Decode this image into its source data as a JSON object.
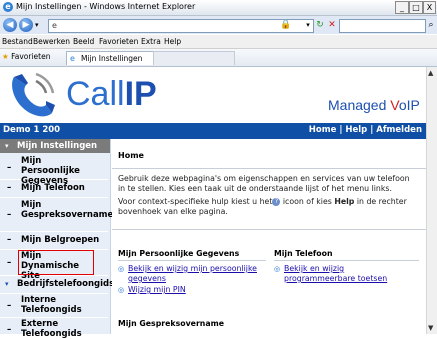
{
  "window": {
    "title": "Mijn Instellingen - Windows Internet Explorer",
    "min": "_",
    "max": "□",
    "close": "X"
  },
  "address": {
    "value": "e"
  },
  "menu": [
    "Bestand",
    "Bewerken",
    "Beeld",
    "Favorieten",
    "Extra",
    "Help"
  ],
  "favorites": {
    "label": "Favorieten",
    "tab_label": "Mijn Instellingen"
  },
  "brand": {
    "name_call": "Call",
    "name_ip": "IP",
    "tagline_managed": "Managed ",
    "tagline_v": "V",
    "tagline_oip": "oIP"
  },
  "bluebar": {
    "company": "Demo 1 200",
    "links": "Home | Help | Afmelden"
  },
  "nav": {
    "section": "Mijn Instellingen",
    "items": [
      {
        "label": "Mijn Persoonlijke Gegevens"
      },
      {
        "label": "Mijn Telefoon"
      },
      {
        "label": "Mijn Gespreksovername"
      },
      {
        "label": "Mijn Belgroepen"
      },
      {
        "label": "Mijn Dynamische Site"
      }
    ],
    "group": "Bedrijfstelefoongids",
    "group_items": [
      {
        "label": "Interne Telefoongids"
      },
      {
        "label": "Externe Telefoongids"
      }
    ]
  },
  "main": {
    "title": "Home",
    "intro1": "Gebruik deze webpagina's om eigenschappen en services van uw telefoon in te stellen. Kies een taak uit de onderstaande lijst of het menu links.",
    "intro2_a": "Voor context-specifieke hulp kiest u het",
    "intro2_b": " icoon of kies ",
    "intro2_help": "Help",
    "intro2_c": " in de rechter bovenhoek van elke pagina.",
    "col1_head": "Mijn Persoonlijke Gegevens",
    "col1_links": [
      "Bekijk en wijzig mijn persoonlijke gegevens",
      "Wijzig mijn PIN"
    ],
    "col2_head": "Mijn Telefoon",
    "col2_links": [
      "Bekijk en wijzig programmeerbare toetsen"
    ],
    "col3_head": "Mijn Gespreksovername"
  },
  "colors": {
    "blue_bar": "#0f4fa6",
    "nav_bg": "#e7eef8",
    "active_outline": "#e00000"
  }
}
